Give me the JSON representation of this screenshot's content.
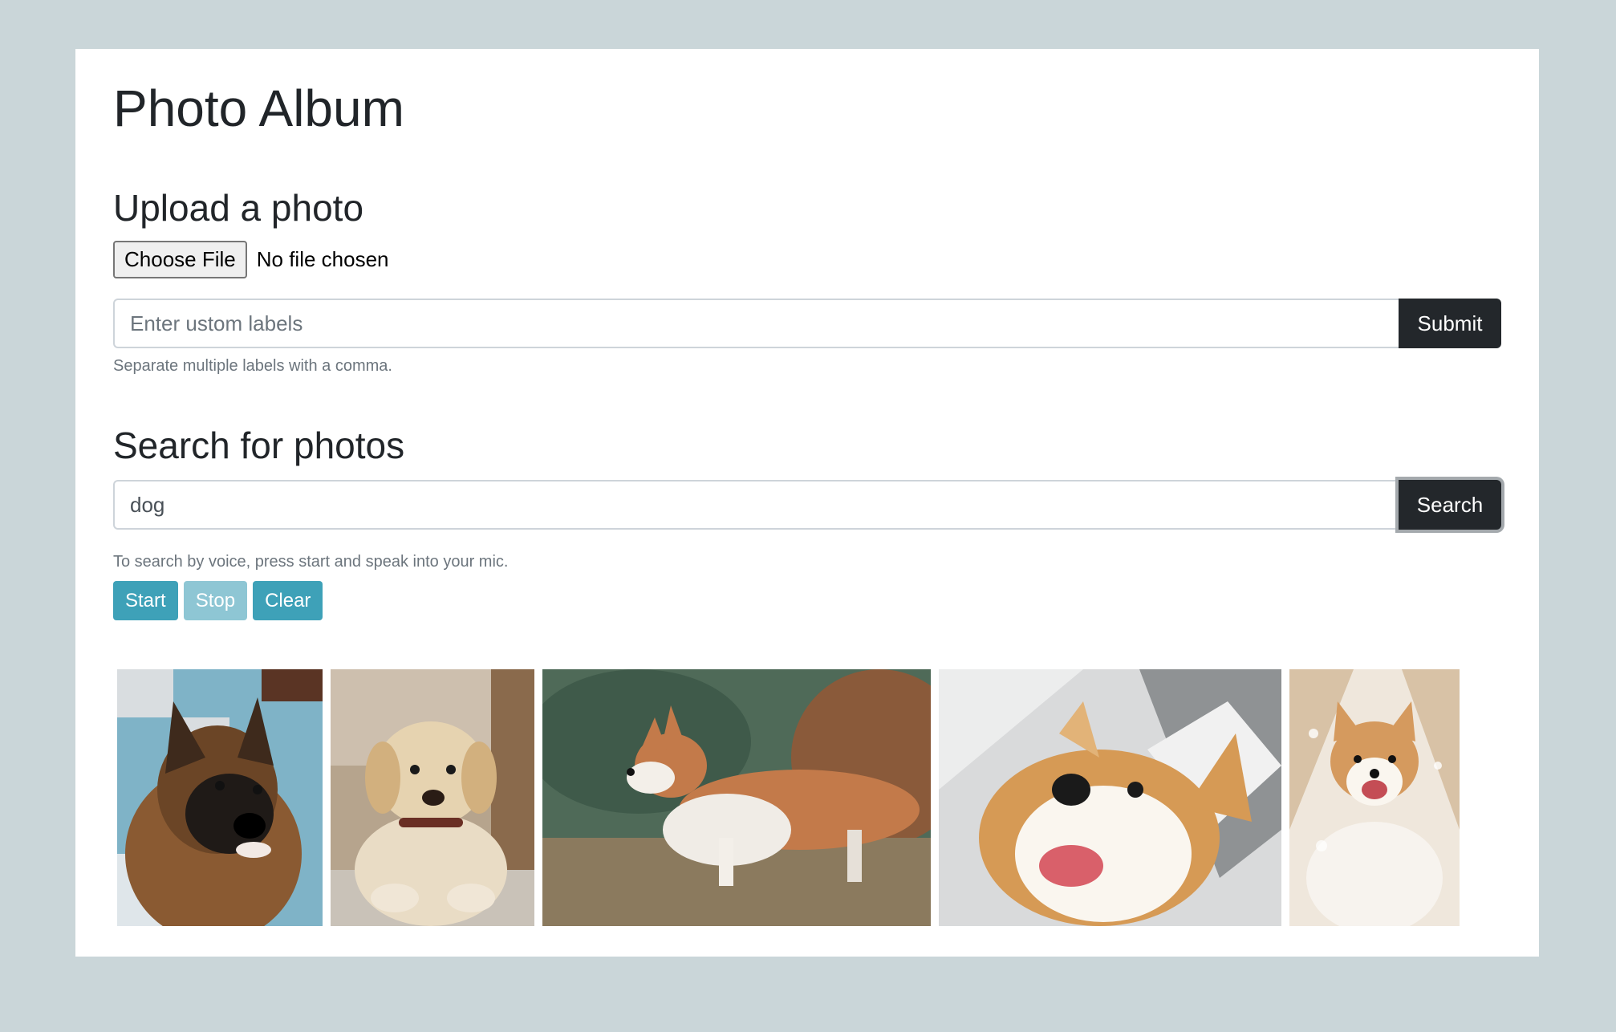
{
  "page": {
    "title": "Photo Album"
  },
  "upload": {
    "heading": "Upload a photo",
    "choose_file_label": "Choose File",
    "file_status": "No file chosen",
    "labels_placeholder": "Enter ustom labels",
    "submit_label": "Submit",
    "help_text": "Separate multiple labels with a comma."
  },
  "search": {
    "heading": "Search for photos",
    "query_value": "dog",
    "search_label": "Search",
    "voice_help": "To search by voice, press start and speak into your mic.",
    "start_label": "Start",
    "stop_label": "Stop",
    "clear_label": "Clear"
  },
  "results": [
    {
      "subject": "german-shepherd-photo"
    },
    {
      "subject": "golden-retriever-puppy-photo"
    },
    {
      "subject": "corgi-standing-photo"
    },
    {
      "subject": "corgi-closeup-photo"
    },
    {
      "subject": "corgi-sitting-photo"
    }
  ],
  "colors": {
    "page_bg": "#cad6d9",
    "dark_button": "#23272b",
    "info_button": "#3ea1b8",
    "info_button_disabled": "#8ec6d4"
  }
}
